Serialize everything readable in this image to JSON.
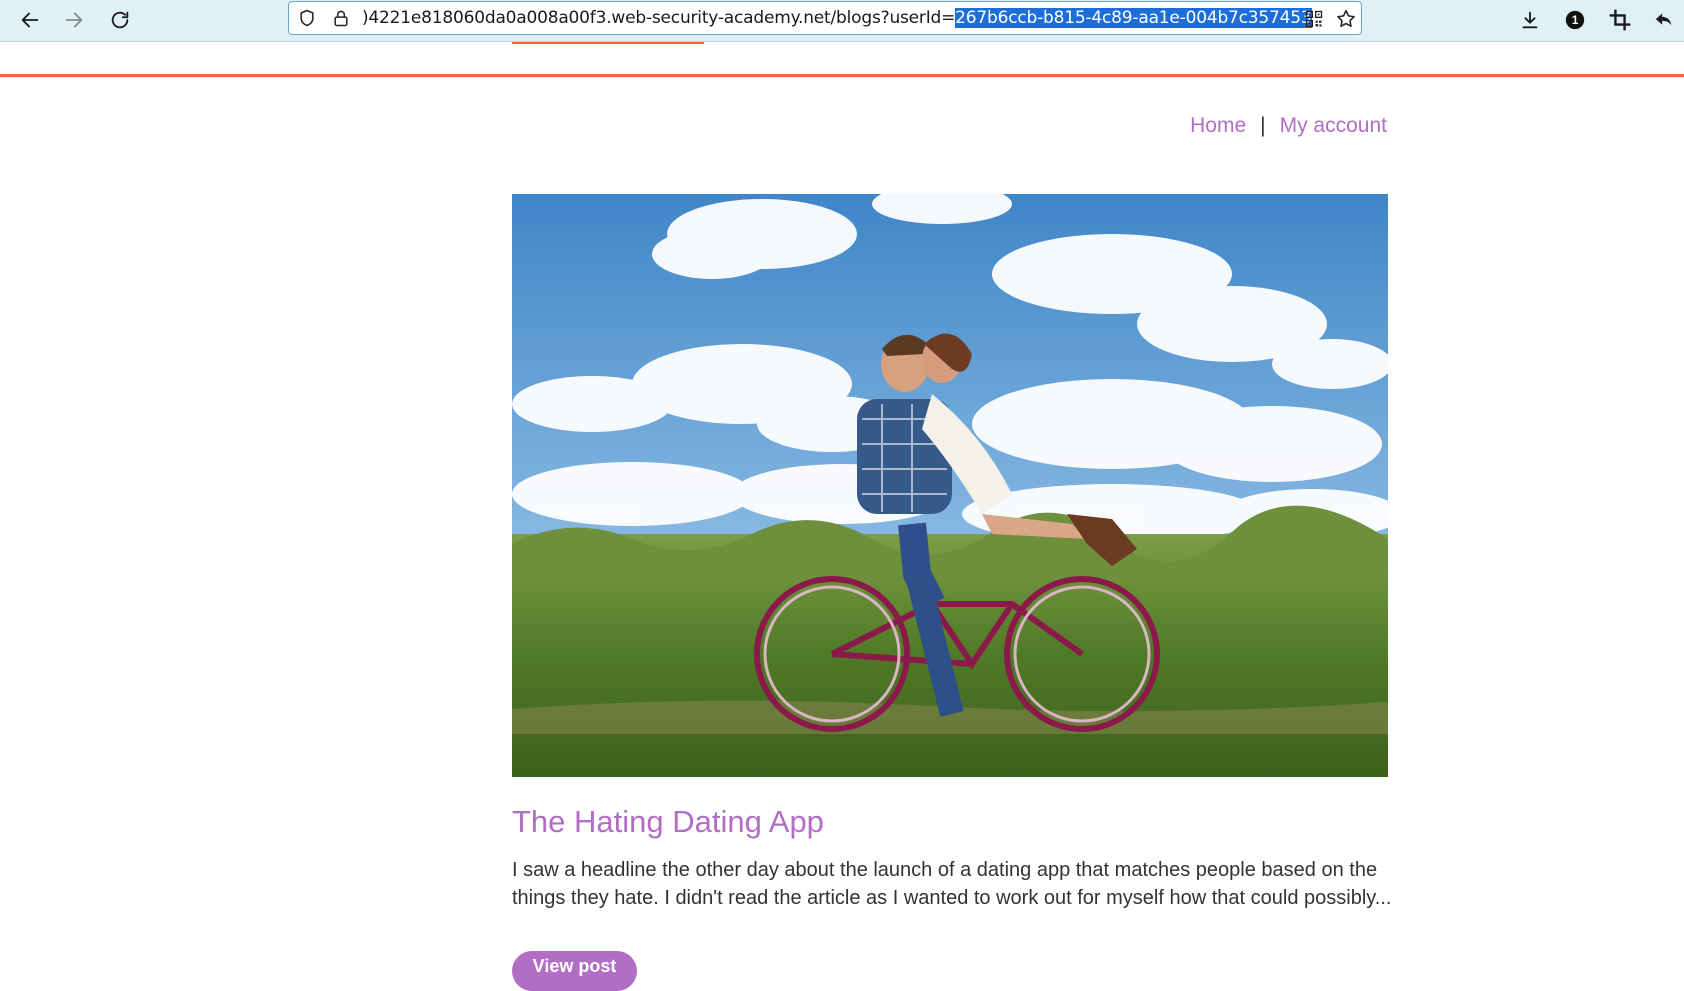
{
  "browser": {
    "url_prefix": ")4221e818060da0a008a00f3.web-security-academy.net/blogs?userId=",
    "url_selected": "267b6ccb-b815-4c89-aa1e-004b7c357453",
    "extensions_badge": "1",
    "icons": {
      "back": "back-arrow-icon",
      "forward": "forward-arrow-icon",
      "reload": "reload-icon",
      "shield": "shield-icon",
      "lock": "lock-icon",
      "qr": "qr-code-icon",
      "bookmark": "star-icon",
      "download": "download-icon",
      "extension": "extension-badge-icon",
      "crop": "crop-icon",
      "undo": "undo-icon"
    }
  },
  "nav": {
    "home": "Home",
    "separator": "|",
    "account": "My account"
  },
  "post": {
    "title": "The Hating Dating App",
    "excerpt": "I saw a headline the other day about the launch of a dating app that matches people based on the things they hate. I didn't read the article as I wanted to work out for myself how that could possibly...",
    "button": "View post"
  },
  "colors": {
    "accent": "#b26ec4",
    "rule": "#f0683a",
    "toolbar_bg": "#dff0f6",
    "selection": "#1d6ed8"
  }
}
